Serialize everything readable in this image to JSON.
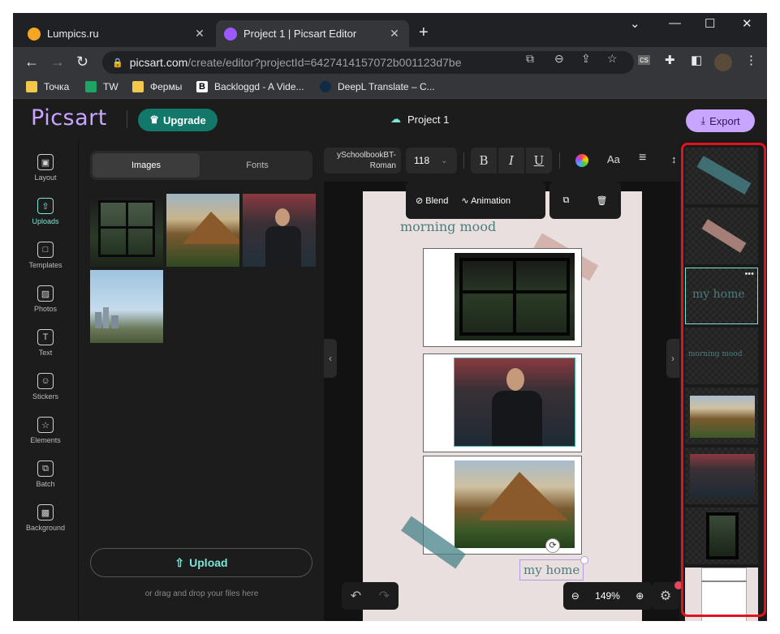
{
  "browser": {
    "tabs": [
      {
        "title": "Lumpics.ru",
        "active": false,
        "favicon_color": "#f5a623"
      },
      {
        "title": "Project 1 | Picsart Editor",
        "active": true,
        "favicon_color": "#9b59ff"
      }
    ],
    "url_host": "picsart.com",
    "url_path": "/create/editor?projectId=6427414157072b001123d7be",
    "bookmarks": [
      {
        "label": "Точка",
        "icon": "folder-icon",
        "color": "#f3c84a"
      },
      {
        "label": "TW",
        "icon": "tw-icon",
        "color": "#1fa463"
      },
      {
        "label": "Фермы",
        "icon": "folder-icon",
        "color": "#f3c84a"
      },
      {
        "label": "Backloggd - A Vide...",
        "icon": "backloggd-icon",
        "color": "#ffffff"
      },
      {
        "label": "DeepL Translate – C...",
        "icon": "deepl-icon",
        "color": "#0f2b46"
      }
    ]
  },
  "app": {
    "logo": "Picsart",
    "upgrade_label": "Upgrade",
    "project_title": "Project 1",
    "export_label": "Export",
    "nav": [
      {
        "label": "Layout",
        "glyph": "▣",
        "active": false
      },
      {
        "label": "Uploads",
        "glyph": "⇧",
        "active": true
      },
      {
        "label": "Templates",
        "glyph": "□",
        "active": false
      },
      {
        "label": "Photos",
        "glyph": "▨",
        "active": false
      },
      {
        "label": "Text",
        "glyph": "T",
        "active": false
      },
      {
        "label": "Stickers",
        "glyph": "☺",
        "active": false
      },
      {
        "label": "Elements",
        "glyph": "☆",
        "active": false
      },
      {
        "label": "Batch",
        "glyph": "⧉",
        "active": false
      },
      {
        "label": "Background",
        "glyph": "▩",
        "active": false
      }
    ],
    "panel": {
      "tab_images": "Images",
      "tab_fonts": "Fonts",
      "upload_label": "Upload",
      "drag_hint": "or drag and drop your files here"
    },
    "text_toolbar": {
      "font_name_line1": "ySchoolbookBT-",
      "font_name_line2": "Roman",
      "font_size": "118",
      "bold": "B",
      "italic": "I",
      "underline": "U",
      "case_label": "Aa"
    },
    "context_menu": {
      "blend": "Blend",
      "animation": "Animation"
    },
    "canvas_text": {
      "morning": "morning mood",
      "home": "my home"
    },
    "zoom": "149%",
    "layers": [
      {
        "type": "tape-teal"
      },
      {
        "type": "tape-pink"
      },
      {
        "type": "text",
        "text": "my home",
        "selected": true
      },
      {
        "type": "text",
        "text": "morning mood",
        "selected": false
      },
      {
        "type": "photo-mountain"
      },
      {
        "type": "photo-man"
      },
      {
        "type": "photo-window"
      },
      {
        "type": "frame"
      }
    ],
    "colors": {
      "accent": "#7ce6d6",
      "brand": "#c8a5ff",
      "upgrade": "#11786a",
      "highlight": "#e0141e"
    }
  }
}
